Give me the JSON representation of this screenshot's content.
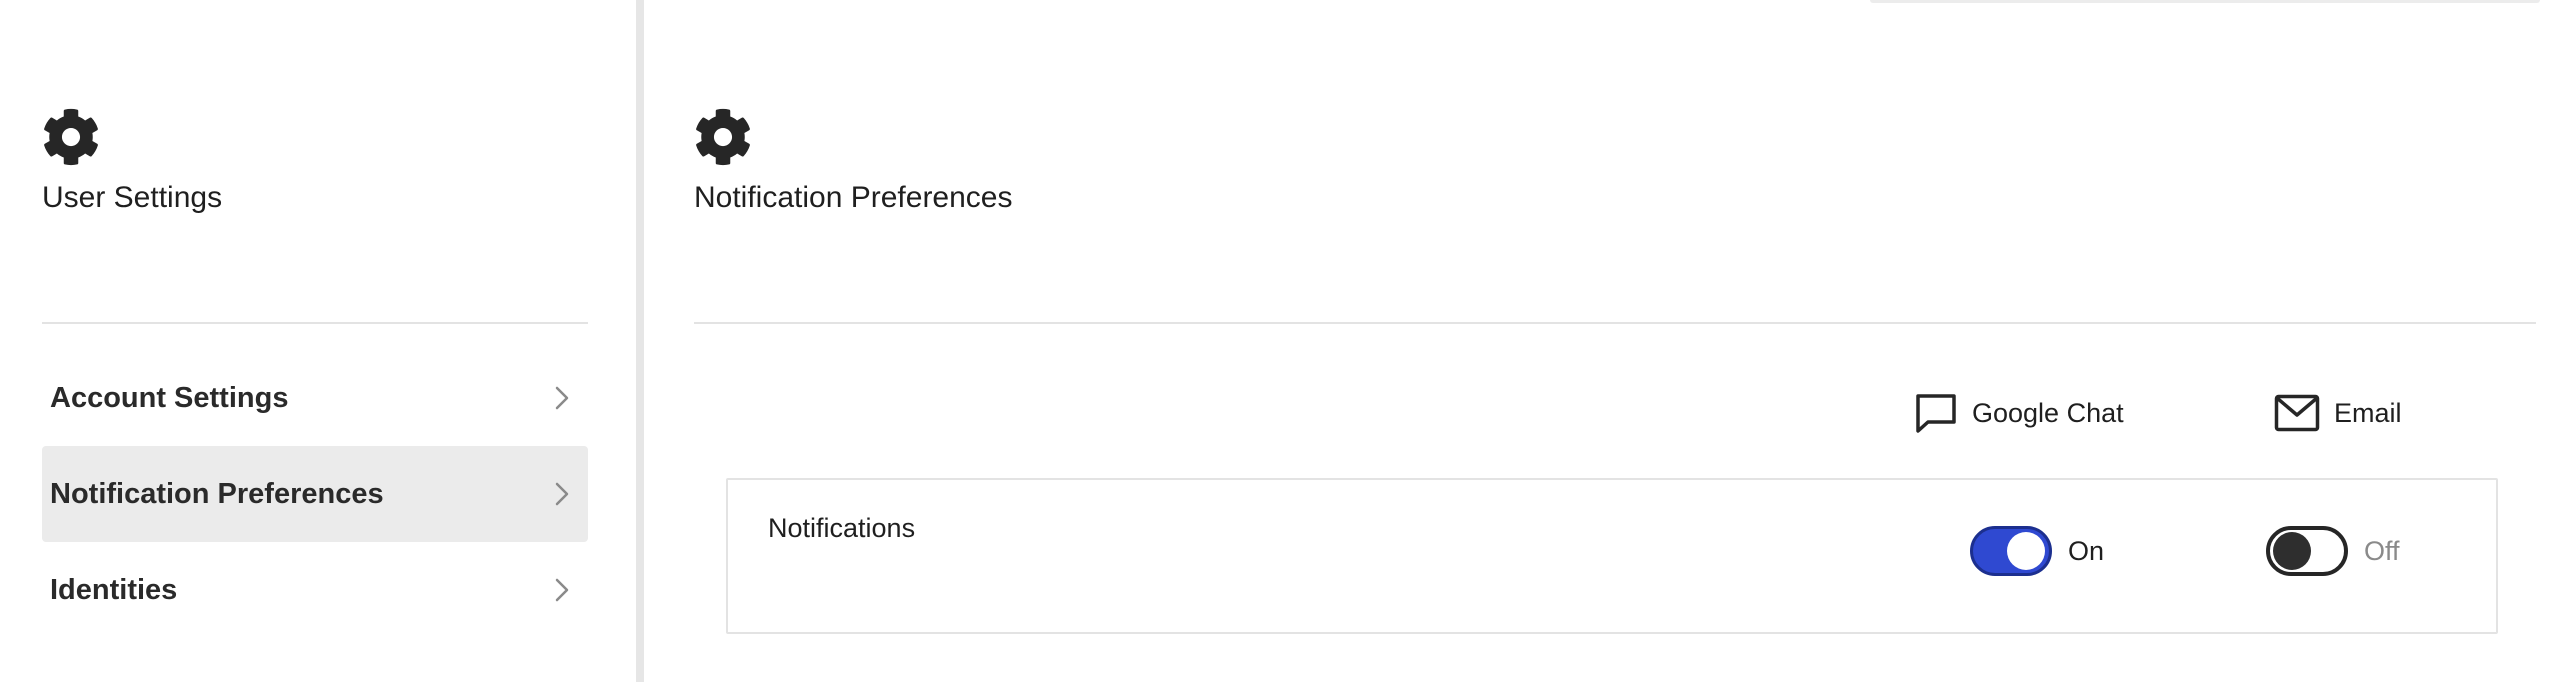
{
  "sidebar": {
    "title": "User Settings",
    "items": [
      {
        "label": "Account Settings",
        "active": false
      },
      {
        "label": "Notification Preferences",
        "active": true
      },
      {
        "label": "Identities",
        "active": false
      }
    ]
  },
  "main": {
    "title": "Notification Preferences",
    "columns": [
      {
        "label": "Google Chat",
        "icon": "chat-bubble-icon"
      },
      {
        "label": "Email",
        "icon": "envelope-icon"
      }
    ],
    "rows": [
      {
        "label": "Notifications",
        "google_chat": {
          "state": "On",
          "enabled": true
        },
        "email": {
          "state": "Off",
          "enabled": false
        }
      }
    ]
  },
  "colors": {
    "toggle_on": "#2f49d1",
    "active_item_bg": "#ebebeb",
    "divider": "#e3e3e3"
  }
}
